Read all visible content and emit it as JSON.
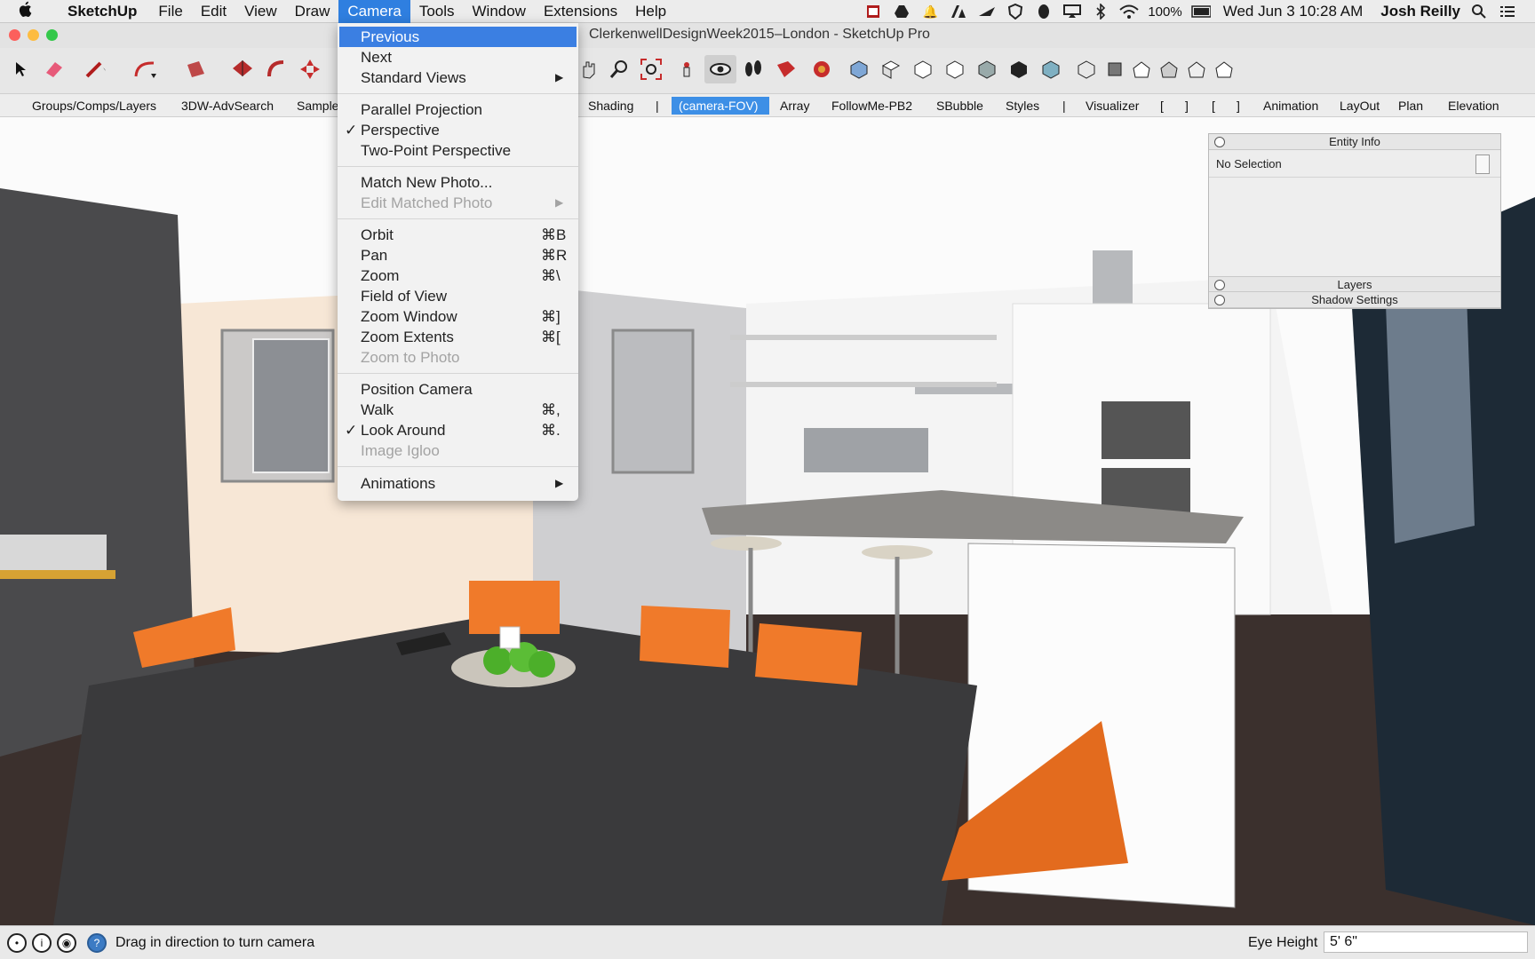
{
  "menubar": {
    "app": "SketchUp",
    "items": [
      "File",
      "Edit",
      "View",
      "Draw",
      "Camera",
      "Tools",
      "Window",
      "Extensions",
      "Help"
    ],
    "battery": "100%",
    "clock": "Wed Jun 3  10:28 AM",
    "user": "Josh Reilly"
  },
  "window": {
    "title": "ClerkenwellDesignWeek2015–London - SketchUp Pro"
  },
  "tabs": [
    "Groups/Comps/Layers",
    "3DW-AdvSearch",
    "Sample",
    "Shading",
    "|",
    "(camera-FOV)",
    "Array",
    "FollowMe-PB2",
    "SBubble",
    "Styles",
    "|",
    "Visualizer",
    "[",
    "]",
    "[",
    "]",
    "Animation",
    "LayOut",
    "Plan",
    "Elevation"
  ],
  "camera_menu": {
    "previous": "Previous",
    "next": "Next",
    "standard_views": "Standard Views",
    "parallel_projection": "Parallel Projection",
    "perspective": "Perspective",
    "two_point_perspective": "Two-Point Perspective",
    "match_new_photo": "Match New Photo...",
    "edit_matched_photo": "Edit Matched Photo",
    "orbit": "Orbit",
    "orbit_shortcut": "⌘B",
    "pan": "Pan",
    "pan_shortcut": "⌘R",
    "zoom": "Zoom",
    "zoom_shortcut": "⌘\\",
    "field_of_view": "Field of View",
    "zoom_window": "Zoom Window",
    "zoom_window_shortcut": "⌘]",
    "zoom_extents": "Zoom Extents",
    "zoom_extents_shortcut": "⌘[",
    "zoom_to_photo": "Zoom to Photo",
    "position_camera": "Position Camera",
    "walk": "Walk",
    "walk_shortcut": "⌘,",
    "look_around": "Look Around",
    "look_around_shortcut": "⌘.",
    "image_igloo": "Image Igloo",
    "animations": "Animations",
    "check": "✓",
    "submenu_arrow": "▶"
  },
  "entity_info": {
    "title": "Entity Info",
    "selection": "No Selection",
    "layers": "Layers",
    "shadow_settings": "Shadow Settings"
  },
  "status": {
    "message": "Drag in direction to turn camera",
    "eye_height_label": "Eye Height",
    "eye_height_value": "5' 6\""
  },
  "colors": {
    "accent": "#3b7fe2",
    "selected_tab": "#3d8fe6",
    "chair": "#f07a2a",
    "table": "#3a3a3c"
  },
  "icons": [
    "apple-icon",
    "select-arrow-icon",
    "eraser-icon",
    "pencil-icon",
    "arc-icon",
    "rectangle-icon",
    "push-pull-icon",
    "follow-me-icon",
    "move-icon",
    "orbit-icon",
    "zoom-icon",
    "zoom-extents-icon",
    "position-camera-icon",
    "look-around-icon",
    "walk-icon"
  ]
}
